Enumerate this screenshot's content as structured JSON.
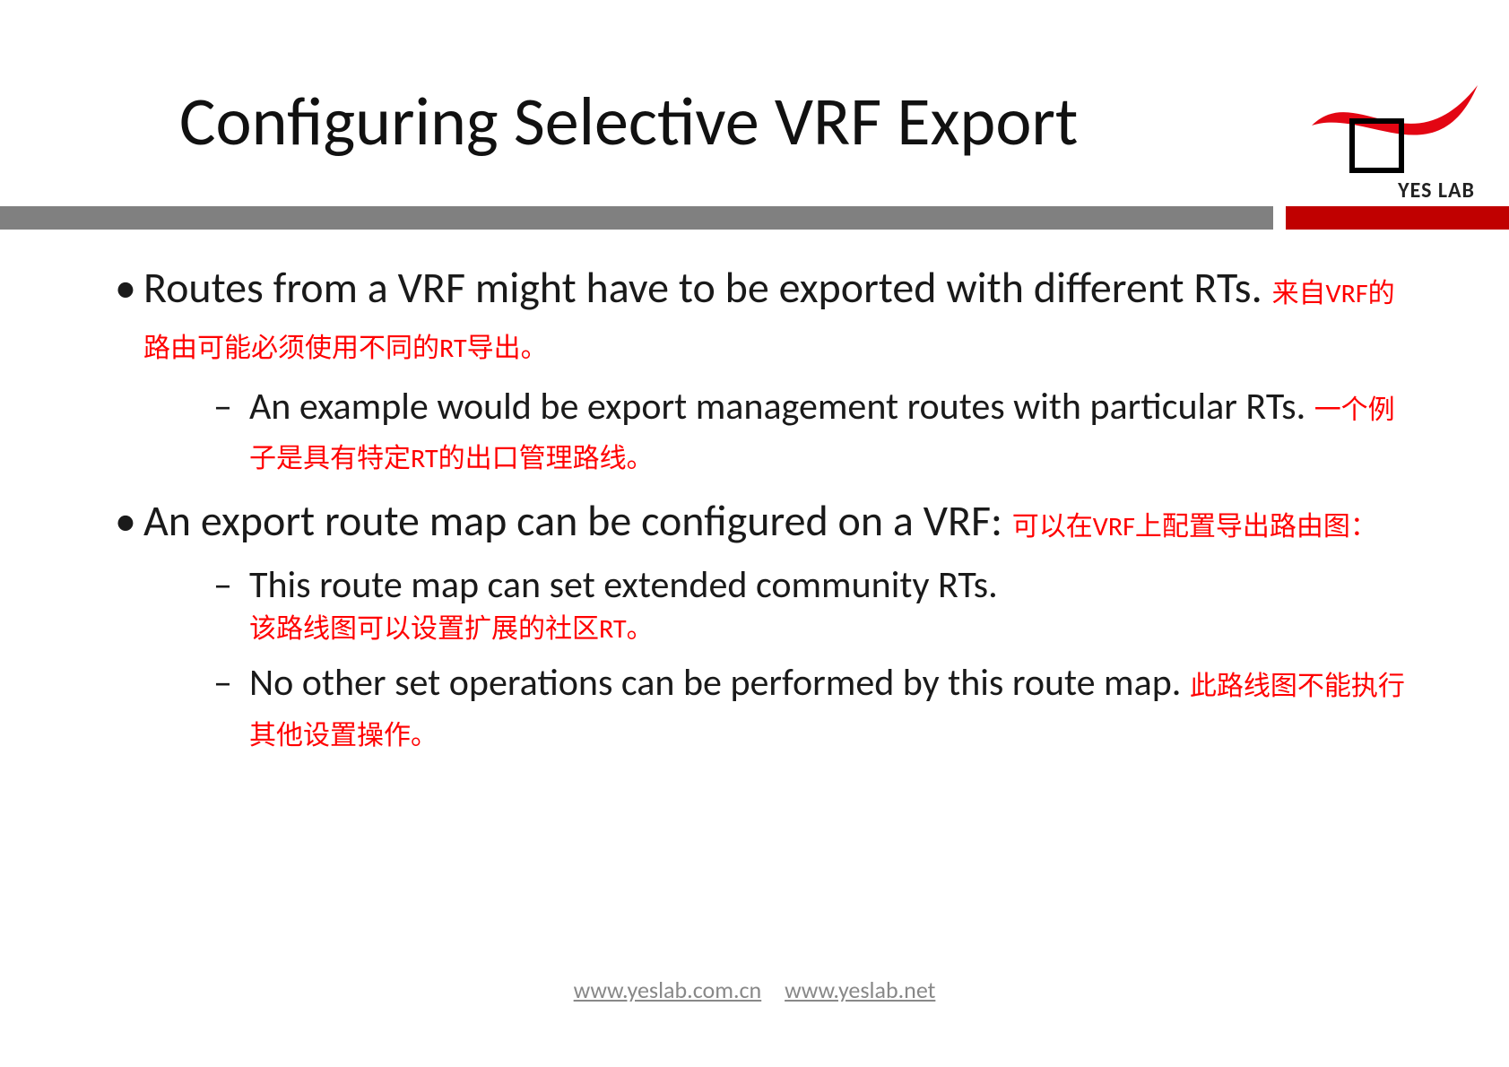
{
  "title": "Configuring Selective VRF Export",
  "logo_text": "YES LAB",
  "bullets": [
    {
      "en": "Routes from a VRF might have to be exported with different RTs.",
      "zh": "来自VRF的路由可能必须使用不同的RT导出。",
      "subs": [
        {
          "en": "An example would be export management routes with particular RTs.",
          "zh": "一个例子是具有特定RT的出口管理路线。"
        }
      ]
    },
    {
      "en": "An export route map can be configured on a VRF:",
      "zh": "可以在VRF上配置导出路由图：",
      "subs": [
        {
          "en": "This route map can set extended community RTs.",
          "zh": "该路线图可以设置扩展的社区RT。"
        },
        {
          "en": "No other set operations can be performed by this route map.",
          "zh": "此路线图不能执行其他设置操作。"
        }
      ]
    }
  ],
  "footer_links": [
    "www.yeslab.com.cn",
    "www.yeslab.net"
  ]
}
